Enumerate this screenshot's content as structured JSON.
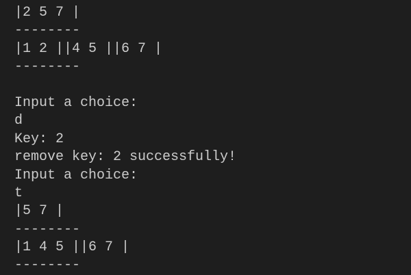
{
  "terminal": {
    "lines": [
      "|2 5 7 |",
      "--------",
      "|1 2 ||4 5 ||6 7 |",
      "--------",
      "",
      "Input a choice:",
      "d",
      "Key: 2",
      "remove key: 2 successfully!",
      "Input a choice:",
      "t",
      "|5 7 |",
      "--------",
      "|1 4 5 ||6 7 |",
      "--------"
    ],
    "colors": {
      "background": "#1e1e1e",
      "text": "#cccccc"
    }
  }
}
